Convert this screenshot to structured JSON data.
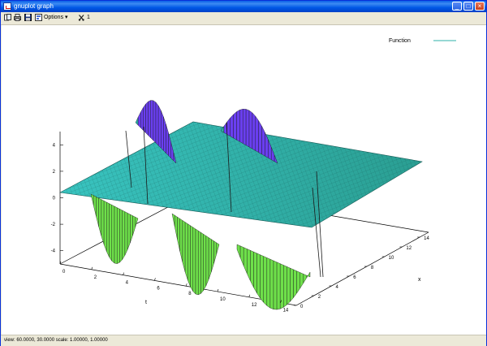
{
  "window": {
    "title": "gnuplot graph",
    "minimize_label": "_",
    "maximize_label": "□",
    "close_label": "×"
  },
  "toolbar": {
    "options_label": "Options",
    "options_arrow": "▾",
    "mouse_label": "1"
  },
  "status": {
    "text": "view: 60.0000, 30.0000   scale: 1.00000, 1.00000"
  },
  "chart_data": {
    "type": "surface",
    "title": "",
    "legend": "Function",
    "xlabel": "x",
    "ylabel": "t",
    "zlabel": "",
    "t_ticks": [
      "0",
      "2",
      "4",
      "6",
      "8",
      "10",
      "12",
      "14"
    ],
    "x_ticks": [
      "0",
      "2",
      "4",
      "6",
      "8",
      "10",
      "12",
      "14"
    ],
    "z_ticks": [
      "4",
      "2",
      "0",
      "-2",
      "-4"
    ],
    "t_range": [
      0,
      15
    ],
    "x_range": [
      0,
      15
    ],
    "z_range": [
      -5,
      5
    ],
    "view": [
      60,
      30
    ],
    "colors": {
      "plane": "#2db2a8",
      "peak": "#6a3ff0",
      "trough": "#6ee04a",
      "mesh": "#1a1a1a"
    }
  }
}
